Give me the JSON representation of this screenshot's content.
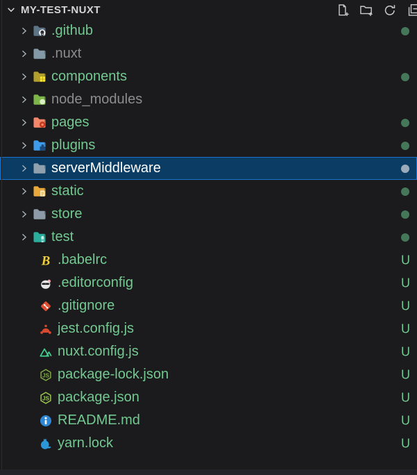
{
  "header": {
    "title": "MY-TEST-NUXT",
    "actions": [
      "new-file-icon",
      "new-folder-icon",
      "refresh-explorer-icon",
      "collapse-all-icon"
    ]
  },
  "theme": {
    "sidebar_background": "#1B1B1D",
    "edge_line": "#2D2D30",
    "bottom_strip": "#242428",
    "header_foreground": "#D4D4D4",
    "chevron": "#A9B2BA",
    "untracked": "#73C991",
    "ignored": "#8C8C8C",
    "selected_foreground": "#FFFFFF",
    "selected_background": "#0B3C63",
    "selected_border": "#1B74CE",
    "dot": "#457859",
    "selected_dot": "#9AABBC"
  },
  "tree": {
    "items": [
      {
        "type": "folder",
        "name": ".github",
        "status": "untracked",
        "badge": "dot",
        "icon": "github-folder-icon",
        "icon_colors": {
          "folder": "#5D7587",
          "badge": "#F2F5F7",
          "detail": "#2B3137"
        }
      },
      {
        "type": "folder",
        "name": ".nuxt",
        "status": "ignored",
        "badge": null,
        "icon": "folder-icon",
        "icon_colors": {
          "folder": "#8499A8"
        }
      },
      {
        "type": "folder",
        "name": "components",
        "status": "untracked",
        "badge": "dot",
        "icon": "components-folder-icon",
        "icon_colors": {
          "folder": "#B3A02C",
          "badge": "#FFE838"
        }
      },
      {
        "type": "folder",
        "name": "node_modules",
        "status": "ignored",
        "badge": null,
        "icon": "node-modules-folder-icon",
        "icon_colors": {
          "folder": "#7CB649",
          "badge": "#D9EFC3"
        }
      },
      {
        "type": "folder",
        "name": "pages",
        "status": "untracked",
        "badge": "dot",
        "icon": "pages-folder-icon",
        "icon_colors": {
          "folder": "#F4876A",
          "badge": "#C63A1F"
        }
      },
      {
        "type": "folder",
        "name": "plugins",
        "status": "untracked",
        "badge": "dot",
        "icon": "plugins-folder-icon",
        "icon_colors": {
          "folder": "#3D9BE9",
          "badge": "#1A4B7D"
        }
      },
      {
        "type": "folder",
        "name": "serverMiddleware",
        "status": "none",
        "selected": true,
        "badge": "dot",
        "icon": "folder-icon",
        "icon_colors": {
          "folder": "#90A0AC"
        }
      },
      {
        "type": "folder",
        "name": "static",
        "status": "untracked",
        "badge": "dot",
        "icon": "static-folder-icon",
        "icon_colors": {
          "folder": "#E9A83B",
          "badge": "#F7EDC3"
        }
      },
      {
        "type": "folder",
        "name": "store",
        "status": "untracked",
        "badge": "dot",
        "icon": "folder-icon",
        "icon_colors": {
          "folder": "#8C9BA7"
        }
      },
      {
        "type": "folder",
        "name": "test",
        "status": "untracked",
        "badge": "dot",
        "icon": "test-folder-icon",
        "icon_colors": {
          "folder": "#2BAE9C",
          "badge": "#CBEFE9"
        }
      },
      {
        "type": "file",
        "name": ".babelrc",
        "status": "untracked",
        "badge": "U",
        "icon": "babel-icon",
        "icon_colors": {
          "main": "#F0CF3E"
        }
      },
      {
        "type": "file",
        "name": ".editorconfig",
        "status": "untracked",
        "badge": "U",
        "icon": "editorconfig-icon",
        "icon_colors": {
          "main": "#E6E6E6",
          "detail": "#333333",
          "accent": "#F2A7B3"
        }
      },
      {
        "type": "file",
        "name": ".gitignore",
        "status": "untracked",
        "badge": "U",
        "icon": "git-icon",
        "icon_colors": {
          "main": "#DE4E31"
        }
      },
      {
        "type": "file",
        "name": "jest.config.js",
        "status": "untracked",
        "badge": "U",
        "icon": "jest-icon",
        "icon_colors": {
          "main": "#D6492F"
        }
      },
      {
        "type": "file",
        "name": "nuxt.config.js",
        "status": "untracked",
        "badge": "U",
        "icon": "nuxt-icon",
        "icon_colors": {
          "main": "#3FCE8E"
        }
      },
      {
        "type": "file",
        "name": "package-lock.json",
        "status": "untracked",
        "badge": "U",
        "icon": "nodejs-icon",
        "icon_colors": {
          "main": "#7FA83F"
        }
      },
      {
        "type": "file",
        "name": "package.json",
        "status": "untracked",
        "badge": "U",
        "icon": "nodejs-icon",
        "icon_colors": {
          "main": "#9CC54F"
        }
      },
      {
        "type": "file",
        "name": "README.md",
        "status": "untracked",
        "badge": "U",
        "icon": "readme-icon",
        "icon_colors": {
          "main": "#2F86D2",
          "detail": "#FFFFFF"
        }
      },
      {
        "type": "file",
        "name": "yarn.lock",
        "status": "untracked",
        "badge": "U",
        "icon": "yarn-icon",
        "icon_colors": {
          "main": "#2B97D8"
        }
      }
    ]
  }
}
